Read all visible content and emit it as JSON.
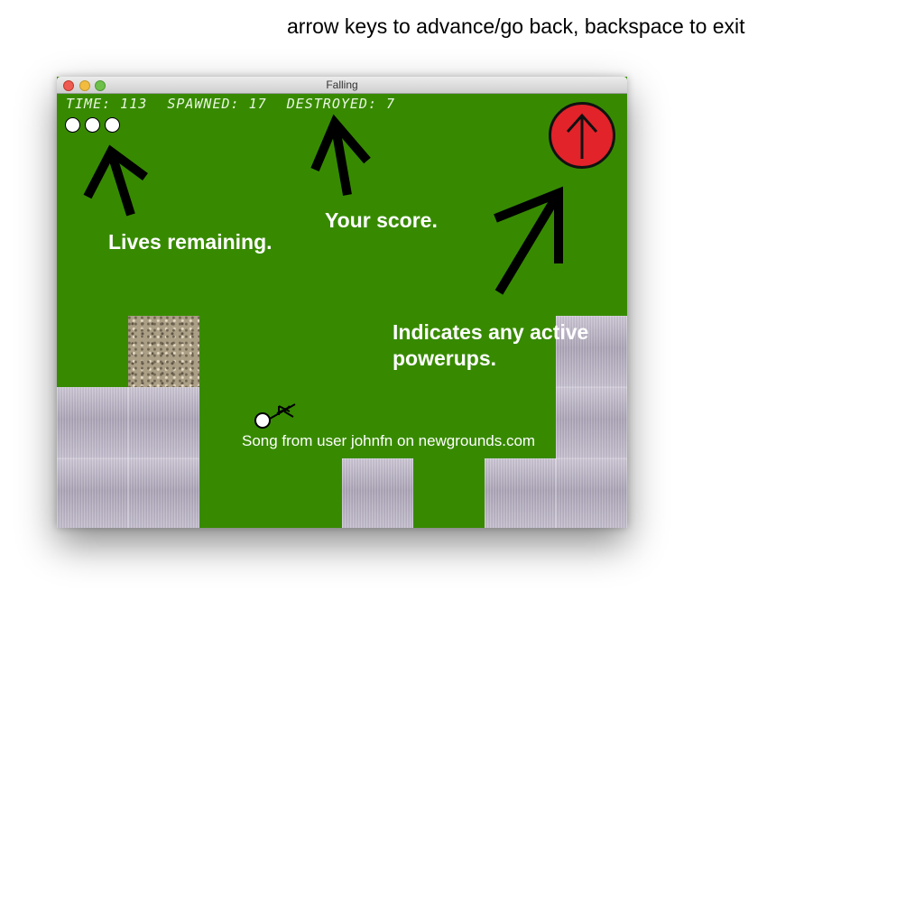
{
  "instructions": "arrow keys to advance/go back, backspace to exit",
  "window": {
    "title": "Falling"
  },
  "hud": {
    "time": "TIME: 113",
    "spawned": "SPAWNED: 17",
    "destroyed": "DESTROYED: 7"
  },
  "lives": 3,
  "powerup": {
    "color": "#e2232a",
    "icon": "up-arrow-icon"
  },
  "annotations": {
    "lives": "Lives remaining.",
    "score": "Your score.",
    "powerups_line1": "Indicates any active",
    "powerups_line2": "powerups."
  },
  "credit": "Song from user johnfn on newgrounds.com",
  "colors": {
    "field": "#378a00",
    "hud_text": "#e8f7e0"
  }
}
